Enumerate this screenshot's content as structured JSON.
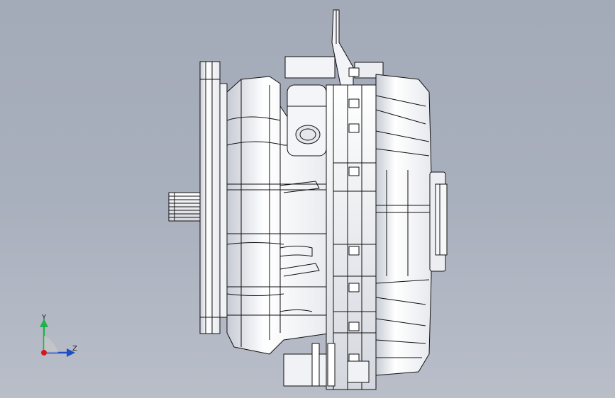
{
  "viewport": {
    "background_top": "#a3aab8",
    "background_bottom": "#b9bec9"
  },
  "model": {
    "icon": "gear-motor-assembly-icon",
    "outline_color": "#111111",
    "shade_color": "#ffffff"
  },
  "triad": {
    "y_label": "Y",
    "z_label": "Z",
    "x_color": "#d2191e",
    "y_color": "#22b24c",
    "z_color": "#1b4ec8"
  }
}
